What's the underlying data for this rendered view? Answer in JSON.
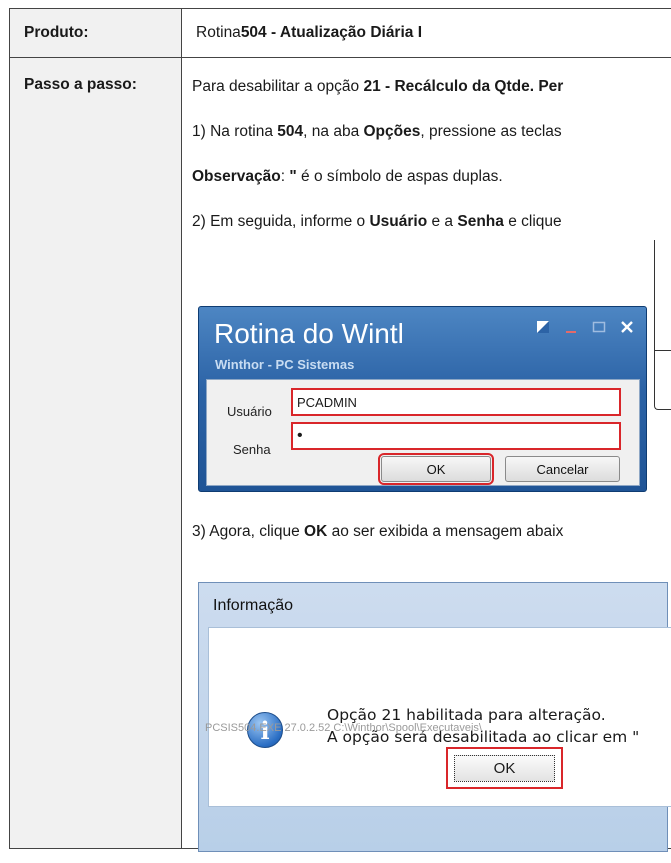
{
  "row1": {
    "label": "Produto:",
    "prefix": "Rotina ",
    "bold": "504 - Atualização Diária I"
  },
  "row2": {
    "label": "Passo a passo:",
    "line1": {
      "prefix": "Para desabilitar a opção ",
      "bold": "21 - Recálculo da Qtde. Per"
    },
    "line2": {
      "p1": "1) Na rotina ",
      "b1": "504",
      "p2": ", na aba ",
      "b2": "Opções",
      "p3": ", pressione as teclas"
    },
    "line3": {
      "b1": "Observação",
      "p1": ": ",
      "b2": "\"",
      "p2": " é o símbolo de aspas duplas."
    },
    "line4": {
      "p1": "2) Em seguida, informe o ",
      "b1": "Usuário",
      "p2": " e a ",
      "b2": "Senha",
      "p3": " e clique"
    },
    "line5": {
      "p1": "3) Agora, clique ",
      "b1": "OK",
      "p2": " ao ser exibida a mensagem abaix"
    }
  },
  "login_dialog": {
    "title": "Rotina do Wintl",
    "subtitle": "Winthor - PC Sistemas",
    "user_label": "Usuário",
    "user_value": "PCADMIN",
    "password_label": "Senha",
    "password_value": "•",
    "ok_label": "OK",
    "cancel_label": "Cancelar"
  },
  "info_dialog": {
    "title": "Informação",
    "message_line1": "Opção 21 habilitada para alteração.",
    "message_line2": "A opção será desabilitada ao clicar em \"",
    "ok_label": "OK",
    "path": "PCSIS504.EXE 27.0.2.52 C:\\Winthor\\Spool\\Executaveis\\"
  },
  "colors": {
    "highlight": "#d9262a",
    "dialog_blue": "#2c63a6"
  }
}
